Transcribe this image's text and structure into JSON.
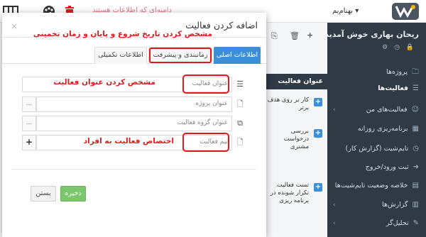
{
  "topbar": {
    "faded_text": "دامنه‌ای که اطلاعات هستند",
    "user_dropdown": "بهنام‌یم ▾",
    "colors": {
      "trash": "#e0191d",
      "toolbar_icon": "#333333"
    }
  },
  "sidebar": {
    "user_name": "ریحان بهاری خوش آمدید",
    "user_icons": "⚙ ◷ 🔒",
    "items": [
      {
        "label": "پروژه‌ها",
        "icon": "folder-icon"
      },
      {
        "label": "فعالیت‌ها",
        "icon": "tasks-icon",
        "active": true
      },
      {
        "label": "فعالیت‌های من",
        "icon": "user-icon"
      },
      {
        "label": "برنامه‌ریزی روزانه",
        "icon": "calendar-icon"
      },
      {
        "label": "تایم‌شیت (گزارش کار)",
        "icon": "clock-icon"
      },
      {
        "label": "ثبت ورود/خروج",
        "icon": "login-icon"
      },
      {
        "label": "خلاصه وضعیت تایم‌شیت‌ها",
        "icon": "table-icon"
      },
      {
        "label": "گزارش‌ها",
        "icon": "report-icon"
      },
      {
        "label": "تحلیل‌گر",
        "icon": "chart-icon"
      }
    ]
  },
  "content": {
    "column_header": "عنوان فعالیت",
    "rows": [
      "کار بر روی هدف برتر",
      "بررسی درخواست مشتری",
      "تست فعالیت تکرار شونده در برنامه ریزی"
    ]
  },
  "modal": {
    "title": "اضافه کردن فعالیت",
    "close": "×",
    "tabs": [
      "اطلاعات اصلی",
      "زمانبندی و پیشرفت",
      "اطلاعات تکمیلی"
    ],
    "annotations": {
      "schedule": "مشخص کردن تاریخ شروع و پایان و زمان تخمینی",
      "title": "مشخص کردن عنوان فعالیت",
      "team": "اختصاص فعالیت به افراد"
    },
    "fields": {
      "title_placeholder": "عنوان فعالیت",
      "project_placeholder": "عنوان پروژه",
      "group_placeholder": "عنوان گروه فعالیت",
      "team_placeholder": "تیم فعالیت",
      "addon_dots": "...",
      "addon_plus": "+"
    },
    "buttons": {
      "save": "ذخیره",
      "close": "بستن"
    },
    "colors": {
      "accent": "#3a8fd8",
      "highlight": "#e0191d",
      "save": "#7bc86c"
    }
  }
}
